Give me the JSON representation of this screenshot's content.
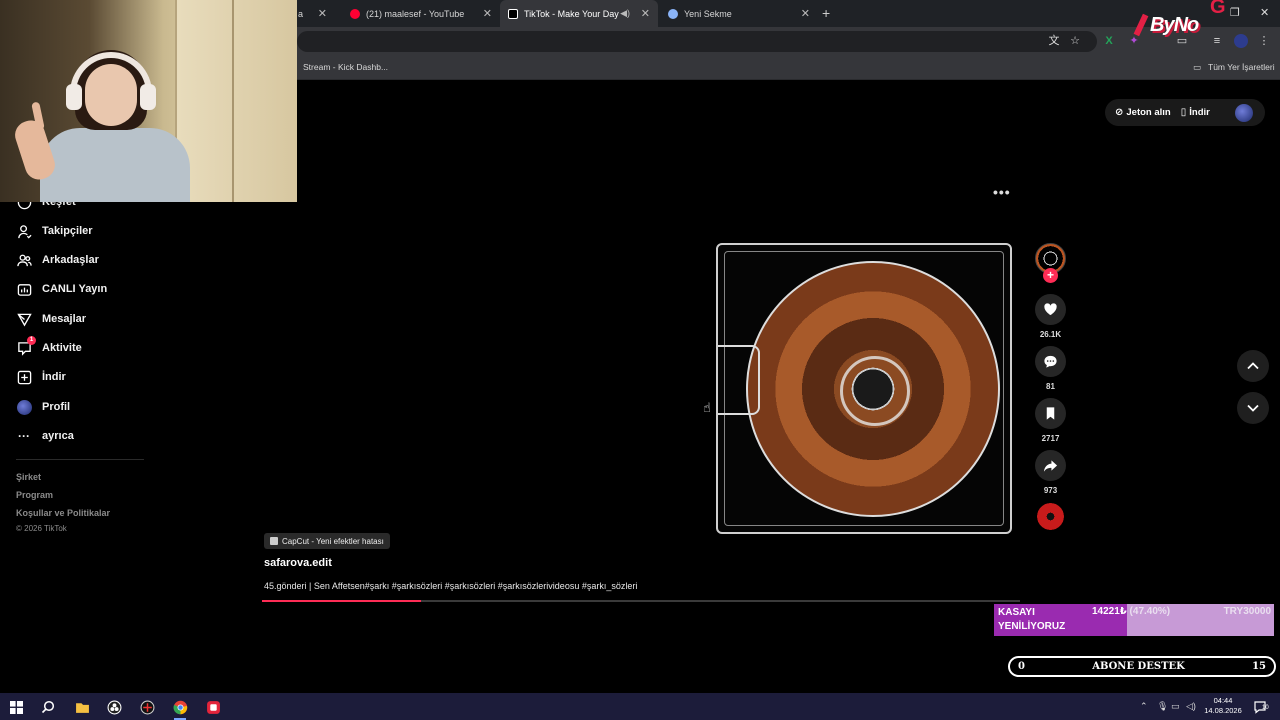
{
  "browser": {
    "tabs": [
      {
        "title": "a",
        "active": false
      },
      {
        "title": "(21) maalesef - YouTube",
        "active": false
      },
      {
        "title": "TikTok - Make Your Day",
        "active": true
      },
      {
        "title": "Yeni Sekme",
        "active": false
      }
    ],
    "bookmarks": {
      "item1": "Stream - Kick Dashb...",
      "all_bookmarks": "Tüm Yer İşaretleri"
    }
  },
  "sidebar": {
    "items": [
      {
        "label": "Keşfet",
        "icon": "compass-icon"
      },
      {
        "label": "Takipçiler",
        "icon": "person-follow-icon"
      },
      {
        "label": "Arkadaşlar",
        "icon": "friends-icon"
      },
      {
        "label": "CANLI Yayın",
        "icon": "live-icon"
      },
      {
        "label": "Mesajlar",
        "icon": "send-icon"
      },
      {
        "label": "Aktivite",
        "icon": "activity-icon",
        "badge": "1"
      },
      {
        "label": "İndir",
        "icon": "plus-square-icon"
      },
      {
        "label": "Profil",
        "icon": "avatar"
      },
      {
        "label": "ayrıca",
        "icon": "ellipsis-icon"
      }
    ],
    "footer": {
      "company": "Şirket",
      "program": "Program",
      "terms": "Koşullar ve Politikalar",
      "copyright": "© 2026 TikTok"
    }
  },
  "header_actions": {
    "coins": "Jeton alın",
    "download": "İndir"
  },
  "video": {
    "effect_label": "CapCut - Yeni efektler hatası",
    "username": "safarova.edit",
    "description": "45.gönderi | Sen Affetsen#şarkı #şarkısözleri #şarkısözleri #şarkısözlerivideosu #şarkı_sözleri",
    "progress": 0.21,
    "likes": "26.1K",
    "comments": "81",
    "saves": "2717",
    "shares": "973"
  },
  "overlay": {
    "logo_text": "ByNo",
    "logo_mark": "G",
    "goal": {
      "label": "KASAYI YENİLİYORUZ",
      "amount": "14221₺",
      "percent": "(47.40%)",
      "target": "TRY30000",
      "fraction": 0.474
    },
    "sub_bar": {
      "left": "0",
      "center": "ABONE DESTEK",
      "right": "15"
    }
  },
  "taskbar": {
    "time": "04:44",
    "date": "14.08.2026",
    "notification_count": "10"
  },
  "colors": {
    "accent": "#fe2c55",
    "goal_fill": "#9a2bb0",
    "goal_bg": "#c79ad6",
    "taskbar": "#1c1c3a"
  }
}
